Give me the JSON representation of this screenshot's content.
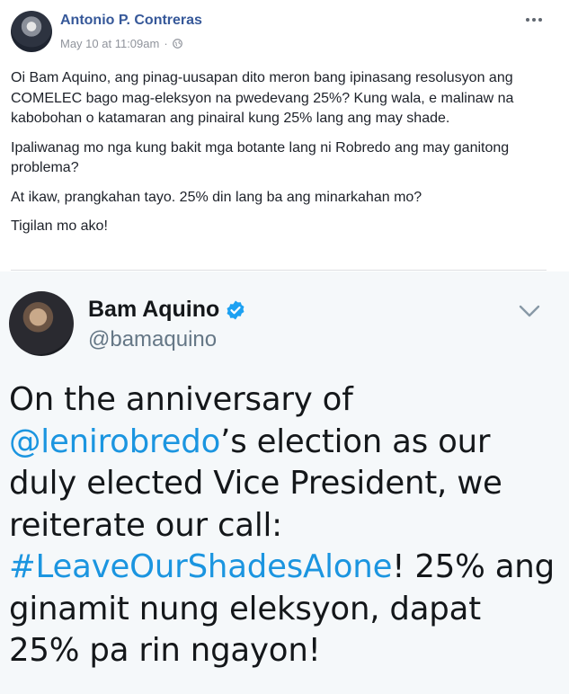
{
  "post": {
    "author": "Antonio P. Contreras",
    "timestamp": "May 10 at 11:09am",
    "separator": "·",
    "paragraphs": [
      "Oi Bam Aquino, ang pinag-uusapan dito meron bang ipinasang resolusyon ang COMELEC bago mag-eleksyon na pwedevang 25%? Kung wala, e malinaw na kabobohan o katamaran ang pinairal kung 25% lang ang may shade.",
      "Ipaliwanag mo nga kung bakit mga botante lang ni Robredo ang may ganitong problema?",
      "At ikaw, prangkahan tayo. 25% din lang ba ang minarkahan mo?",
      "Tigilan mo ako!"
    ]
  },
  "tweet": {
    "name": "Bam Aquino",
    "handle": "@bamaquino",
    "text_part1": "On the anniversary of ",
    "mention": "@lenirobredo",
    "text_part2": "’s election as our duly elected Vice President, we reiterate our call: ",
    "hashtag": "#LeaveOurShadesAlone",
    "text_part3": "! 25% ang ginamit nung eleksyon, dapat 25% pa rin ngayon!"
  },
  "colors": {
    "author_link": "#365899",
    "meta_gray": "#90949c",
    "tweet_link": "#1b95e0",
    "verified_blue": "#1da1f2",
    "tweet_bg": "#f5f8fa"
  },
  "icons": {
    "privacy": "globe-icon",
    "more": "more-options-icon",
    "verified": "verified-badge-icon",
    "tweet_menu": "chevron-down-icon"
  }
}
